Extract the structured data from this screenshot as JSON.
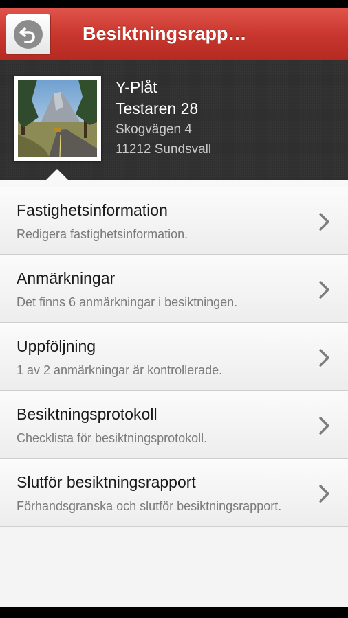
{
  "navbar": {
    "title": "Besiktningsrapp…",
    "back_icon": "back-arrow-icon",
    "color": "#c9372e"
  },
  "property": {
    "line1": "Y-Plåt",
    "line2": "Testaren 28",
    "line3": "Skogvägen 4",
    "line4": "11212 Sundsvall"
  },
  "menu": [
    {
      "title": "Fastighetsinformation",
      "subtitle": "Redigera fastighetsinformation."
    },
    {
      "title": "Anmärkningar",
      "subtitle": "Det finns 6 anmärkningar i besiktningen."
    },
    {
      "title": "Uppföljning",
      "subtitle": "1 av 2 anmärkningar är kontrollerade."
    },
    {
      "title": "Besiktningsprotokoll",
      "subtitle": "Checklista för besiktningsprotokoll."
    },
    {
      "title": "Slutför besiktningsrapport",
      "subtitle": "Förhandsgranska och slutför besiktningsrapport."
    }
  ]
}
